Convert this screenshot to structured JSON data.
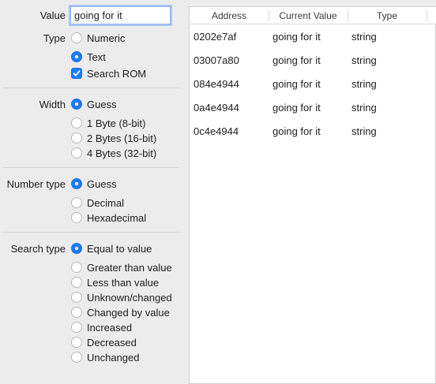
{
  "search_form": {
    "value_label": "Value",
    "value_input": "going for it",
    "type": {
      "label": "Type",
      "options": [
        "Numeric",
        "Text"
      ],
      "selected": "Text",
      "search_rom_label": "Search ROM",
      "search_rom_checked": true
    },
    "width": {
      "label": "Width",
      "options": [
        "Guess",
        "1 Byte (8-bit)",
        "2 Bytes (16-bit)",
        "4 Bytes (32-bit)"
      ],
      "selected": "Guess"
    },
    "number_type": {
      "label": "Number type",
      "options": [
        "Guess",
        "Decimal",
        "Hexadecimal"
      ],
      "selected": "Guess"
    },
    "search_type": {
      "label": "Search type",
      "options": [
        "Equal to value",
        "Greater than value",
        "Less than value",
        "Unknown/changed",
        "Changed by value",
        "Increased",
        "Decreased",
        "Unchanged"
      ],
      "selected": "Equal to value"
    }
  },
  "results_table": {
    "columns": [
      "Address",
      "Current Value",
      "Type"
    ],
    "rows": [
      {
        "address": "0202e7af",
        "value": "going for it",
        "type": "string"
      },
      {
        "address": "03007a80",
        "value": "going for it",
        "type": "string"
      },
      {
        "address": "084e4944",
        "value": "going for it",
        "type": "string"
      },
      {
        "address": "0a4e4944",
        "value": "going for it",
        "type": "string"
      },
      {
        "address": "0c4e4944",
        "value": "going for it",
        "type": "string"
      }
    ]
  },
  "colors": {
    "accent": "#1c7cf3",
    "panel_bg": "#ececec"
  }
}
